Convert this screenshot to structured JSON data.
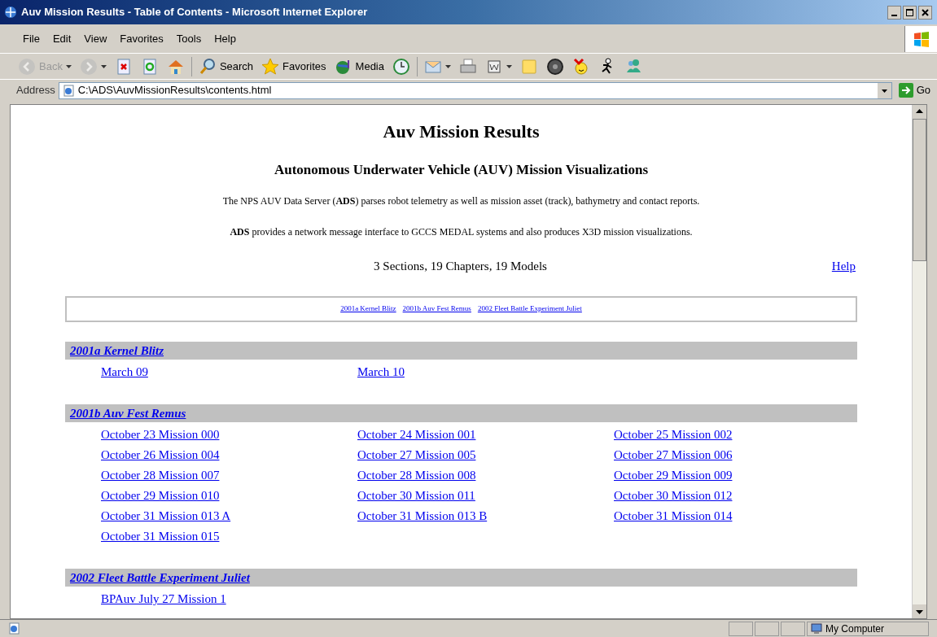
{
  "window": {
    "title": "Auv Mission Results - Table of Contents - Microsoft Internet Explorer"
  },
  "menu": [
    "File",
    "Edit",
    "View",
    "Favorites",
    "Tools",
    "Help"
  ],
  "toolbar": [
    {
      "kind": "back",
      "label": "Back",
      "disabled": true
    },
    {
      "kind": "forward",
      "disabled": true
    },
    {
      "kind": "stop"
    },
    {
      "kind": "refresh"
    },
    {
      "kind": "home"
    },
    {
      "kind": "search",
      "label": "Search"
    },
    {
      "kind": "favorites",
      "label": "Favorites"
    },
    {
      "kind": "media",
      "label": "Media"
    },
    {
      "kind": "history"
    },
    {
      "kind": "mail"
    },
    {
      "kind": "print"
    },
    {
      "kind": "edit"
    },
    {
      "kind": "note"
    },
    {
      "kind": "disc"
    },
    {
      "kind": "smiley"
    },
    {
      "kind": "runner"
    },
    {
      "kind": "people"
    }
  ],
  "address": {
    "label": "Address",
    "value": "C:\\ADS\\AuvMissionResults\\contents.html",
    "go": "Go"
  },
  "page": {
    "title": "Auv Mission Results",
    "subtitle": "Autonomous Underwater Vehicle (AUV) Mission Visualizations",
    "paragraphs": [
      "The NPS AUV Data Server (**ADS**) parses robot telemetry as well as mission asset (track), bathymetry and contact reports.",
      "**ADS** provides a network message interface to GCCS MEDAL systems and also produces X3D mission visualizations."
    ],
    "summary": "3 Sections, 19 Chapters, 19 Models",
    "help": "Help",
    "nav": [
      "2001a Kernel Blitz",
      "2001b Auv Fest Remus",
      "2002 Fleet Battle Experiment Juliet"
    ],
    "sections": [
      {
        "title": "2001a Kernel Blitz",
        "links": [
          "March 09",
          "March 10"
        ]
      },
      {
        "title": "2001b Auv Fest Remus",
        "links": [
          "October 23 Mission 000",
          "October 24 Mission 001",
          "October 25 Mission 002",
          "October 26 Mission 004",
          "October 27 Mission 005",
          "October 27 Mission 006",
          "October 28 Mission 007",
          "October 28 Mission 008",
          "October 29 Mission 009",
          "October 29 Mission 010",
          "October 30 Mission 011",
          "October 30 Mission 012",
          "October 31 Mission 013 A",
          "October 31 Mission 013 B",
          "October 31 Mission 014",
          "October 31 Mission 015"
        ]
      },
      {
        "title": "2002 Fleet Battle Experiment Juliet",
        "links": [
          "BPAuv July 27 Mission 1"
        ]
      }
    ]
  },
  "status_bar": {
    "zone": "My Computer"
  }
}
